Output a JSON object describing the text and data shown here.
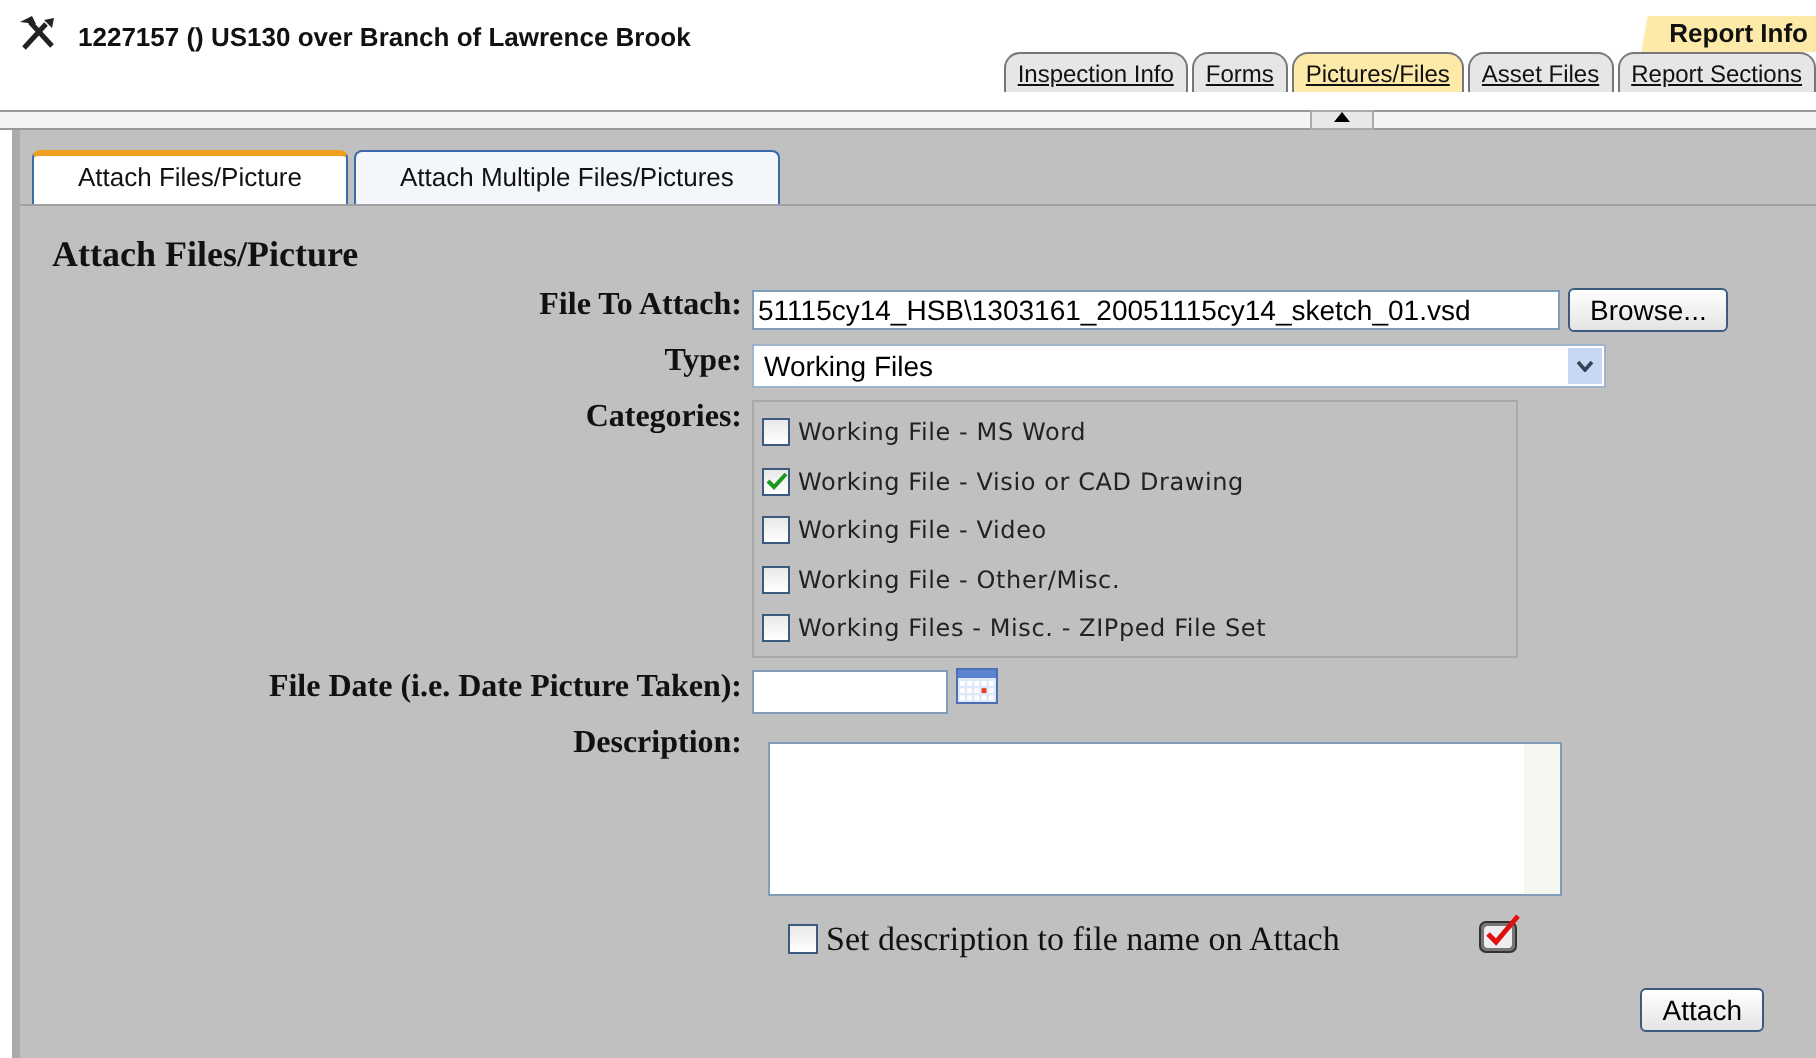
{
  "header": {
    "title": "1227157 () US130 over Branch of Lawrence Brook"
  },
  "report_tab": {
    "label": "Report Info",
    "selected": true
  },
  "top_tabs": [
    {
      "label": "Inspection Info",
      "selected": false
    },
    {
      "label": "Forms",
      "selected": false
    },
    {
      "label": "Pictures/Files",
      "selected": true
    },
    {
      "label": "Asset Files",
      "selected": false
    },
    {
      "label": "Report Sections",
      "selected": false
    }
  ],
  "sub_tabs": [
    {
      "label": "Attach Files/Picture",
      "selected": true
    },
    {
      "label": "Attach Multiple Files/Pictures",
      "selected": false
    }
  ],
  "form": {
    "heading": "Attach Files/Picture",
    "file_label": "File To Attach:",
    "file_value": "51115cy14_HSB\\1303161_20051115cy14_sketch_01.vsd",
    "browse_button": "Browse...",
    "type_label": "Type:",
    "type_value": "Working Files",
    "categories_label": "Categories:",
    "categories": [
      {
        "label": "Working File - MS Word",
        "checked": false
      },
      {
        "label": "Working File - Visio or CAD Drawing",
        "checked": true
      },
      {
        "label": "Working File - Video",
        "checked": false
      },
      {
        "label": "Working File - Other/Misc.",
        "checked": false
      },
      {
        "label": "Working Files - Misc. - ZIPped File Set",
        "checked": false
      }
    ],
    "date_label": "File Date (i.e. Date Picture Taken):",
    "description_label": "Description:",
    "set_description": {
      "label": "Set description to file name on Attach",
      "checked": false
    },
    "attach_button": "Attach"
  }
}
